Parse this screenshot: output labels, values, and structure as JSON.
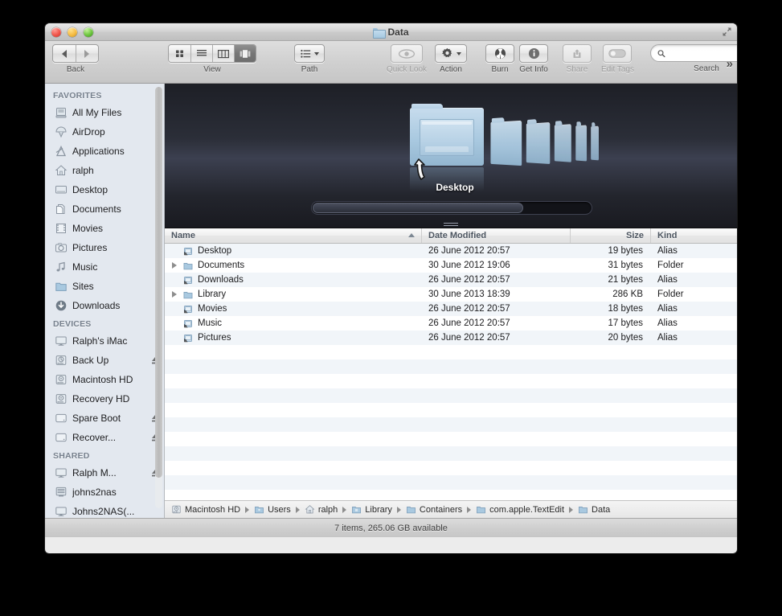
{
  "window": {
    "title": "Data",
    "title_icon": "folder-icon",
    "controls": {
      "close": "close-button",
      "minimize": "minimize-button",
      "zoom": "zoom-button"
    },
    "fullscreen_icon": "fullscreen-icon"
  },
  "toolbar": {
    "back_label": "Back",
    "back_icon": "back-arrow-icon",
    "forward_icon": "forward-arrow-icon",
    "view_label": "View",
    "view_options": [
      "icon-view",
      "list-view",
      "column-view",
      "cover-flow-view"
    ],
    "view_selected": "cover-flow-view",
    "path_label": "Path",
    "path_icon": "path-list-icon",
    "quick_look_label": "Quick Look",
    "quick_look_icon": "eye-icon",
    "action_label": "Action",
    "action_icon": "gear-icon",
    "burn_label": "Burn",
    "burn_icon": "burn-icon",
    "get_info_label": "Get Info",
    "get_info_icon": "info-icon",
    "share_label": "Share",
    "share_icon": "share-icon",
    "edit_tags_label": "Edit Tags",
    "edit_tags_icon": "tag-toggle-icon",
    "search_label": "Search",
    "search_placeholder": "",
    "search_value": "",
    "search_icon": "search-icon",
    "overflow_icon": "chevron-double-right-icon"
  },
  "sidebar": {
    "sections": [
      {
        "header": "FAVORITES",
        "items": [
          {
            "label": "All My Files",
            "icon": "all-my-files-icon",
            "eject": false
          },
          {
            "label": "AirDrop",
            "icon": "airdrop-icon",
            "eject": false
          },
          {
            "label": "Applications",
            "icon": "applications-icon",
            "eject": false
          },
          {
            "label": "ralph",
            "icon": "home-icon",
            "eject": false
          },
          {
            "label": "Desktop",
            "icon": "desktop-icon",
            "eject": false
          },
          {
            "label": "Documents",
            "icon": "documents-icon",
            "eject": false
          },
          {
            "label": "Movies",
            "icon": "movies-icon",
            "eject": false
          },
          {
            "label": "Pictures",
            "icon": "pictures-icon",
            "eject": false
          },
          {
            "label": "Music",
            "icon": "music-icon",
            "eject": false
          },
          {
            "label": "Sites",
            "icon": "sites-folder-icon",
            "eject": false
          },
          {
            "label": "Downloads",
            "icon": "downloads-icon",
            "eject": false
          }
        ]
      },
      {
        "header": "DEVICES",
        "items": [
          {
            "label": "Ralph's iMac",
            "icon": "imac-icon",
            "eject": false
          },
          {
            "label": "Back Up",
            "icon": "time-machine-disk-icon",
            "eject": true
          },
          {
            "label": "Macintosh HD",
            "icon": "hard-disk-icon",
            "eject": false
          },
          {
            "label": "Recovery HD",
            "icon": "hard-disk-icon",
            "eject": false
          },
          {
            "label": "Spare Boot",
            "icon": "external-disk-icon",
            "eject": true
          },
          {
            "label": "Recover...",
            "icon": "external-disk-icon",
            "eject": true
          }
        ]
      },
      {
        "header": "SHARED",
        "items": [
          {
            "label": "Ralph M...",
            "icon": "shared-mac-icon",
            "eject": true
          },
          {
            "label": "johns2nas",
            "icon": "nas-server-icon",
            "eject": false
          },
          {
            "label": "Johns2NAS(...",
            "icon": "shared-mac-icon",
            "eject": false
          }
        ]
      }
    ]
  },
  "coverflow": {
    "selected_label": "Desktop",
    "cursor_icon": "alias-arrow-cursor",
    "scrubber": "coverflow-scrubber",
    "resize_grip": "coverflow-resize-grip"
  },
  "filelist": {
    "columns": [
      {
        "key": "name",
        "label": "Name",
        "sorted": true,
        "sort_dir": "ascending"
      },
      {
        "key": "date",
        "label": "Date Modified",
        "sorted": false
      },
      {
        "key": "size",
        "label": "Size",
        "sorted": false
      },
      {
        "key": "kind",
        "label": "Kind",
        "sorted": false
      }
    ],
    "rows": [
      {
        "name": "Desktop",
        "date": "26 June 2012 20:57",
        "size": "19 bytes",
        "kind": "Alias",
        "icon": "alias-folder-icon",
        "expandable": false
      },
      {
        "name": "Documents",
        "date": "30 June 2012 19:06",
        "size": "31 bytes",
        "kind": "Folder",
        "icon": "folder-icon",
        "expandable": true
      },
      {
        "name": "Downloads",
        "date": "26 June 2012 20:57",
        "size": "21 bytes",
        "kind": "Alias",
        "icon": "alias-downloads-icon",
        "expandable": false
      },
      {
        "name": "Library",
        "date": "30 June 2013 18:39",
        "size": "286 KB",
        "kind": "Folder",
        "icon": "folder-icon",
        "expandable": true
      },
      {
        "name": "Movies",
        "date": "26 June 2012 20:57",
        "size": "18 bytes",
        "kind": "Alias",
        "icon": "alias-movies-icon",
        "expandable": false
      },
      {
        "name": "Music",
        "date": "26 June 2012 20:57",
        "size": "17 bytes",
        "kind": "Alias",
        "icon": "alias-music-icon",
        "expandable": false
      },
      {
        "name": "Pictures",
        "date": "26 June 2012 20:57",
        "size": "20 bytes",
        "kind": "Alias",
        "icon": "alias-pictures-icon",
        "expandable": false
      }
    ],
    "empty_row_count": 13
  },
  "pathbar": {
    "items": [
      {
        "label": "Macintosh HD",
        "icon": "hard-disk-icon"
      },
      {
        "label": "Users",
        "icon": "users-folder-icon"
      },
      {
        "label": "ralph",
        "icon": "home-icon"
      },
      {
        "label": "Library",
        "icon": "library-folder-icon"
      },
      {
        "label": "Containers",
        "icon": "folder-icon"
      },
      {
        "label": "com.apple.TextEdit",
        "icon": "folder-icon"
      },
      {
        "label": "Data",
        "icon": "folder-icon"
      }
    ]
  },
  "statusbar": {
    "text": "7 items, 265.06 GB available"
  },
  "colors": {
    "sidebar_bg": "#e3e8ef",
    "row_alt": "#f1f5f9",
    "header_text": "#4c5560",
    "coverflow_bg": "#2b2e38",
    "folder_blue": "#a9c9e0"
  }
}
